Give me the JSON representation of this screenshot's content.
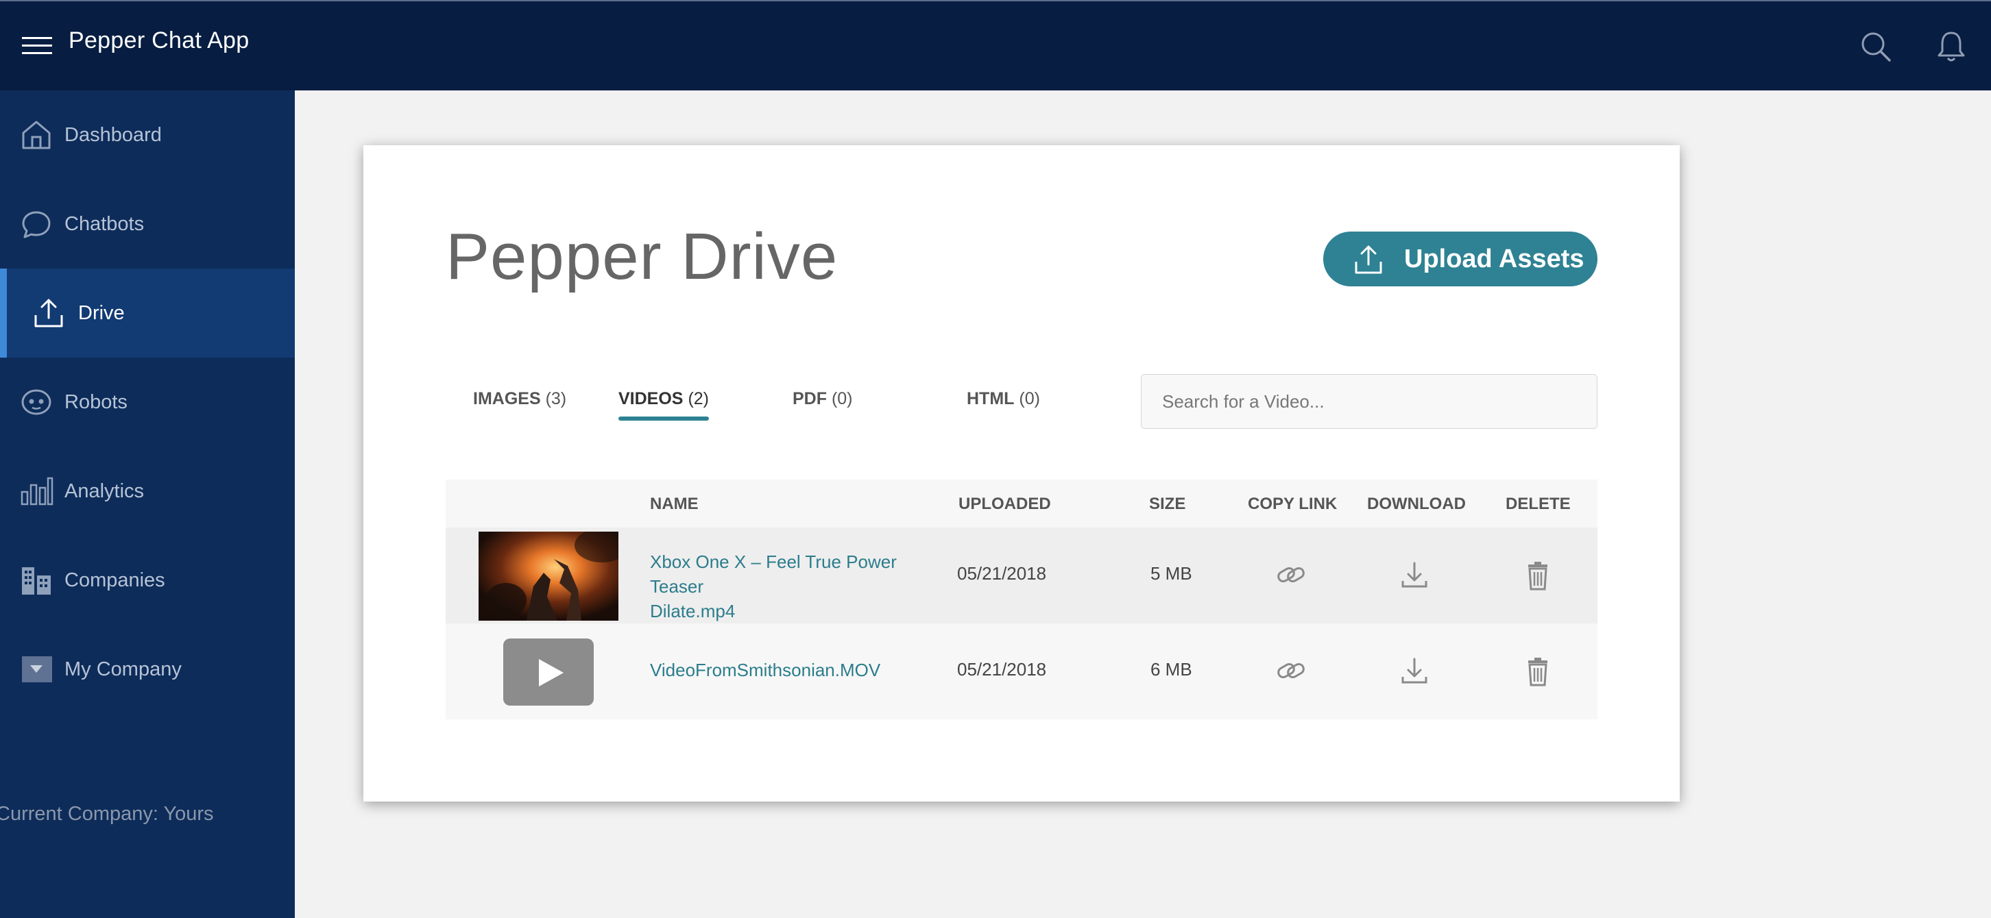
{
  "app": {
    "title": "Pepper Chat App"
  },
  "header_icons": [
    "menu-icon",
    "search-icon",
    "bell-icon"
  ],
  "sidebar": {
    "items": [
      {
        "label": "Dashboard",
        "icon": "home-icon",
        "active": false
      },
      {
        "label": "Chatbots",
        "icon": "chat-bubble-icon",
        "active": false
      },
      {
        "label": "Drive",
        "icon": "upload-icon",
        "active": true
      },
      {
        "label": "Robots",
        "icon": "robot-icon",
        "active": false
      },
      {
        "label": "Analytics",
        "icon": "bar-chart-icon",
        "active": false
      },
      {
        "label": "Companies",
        "icon": "buildings-icon",
        "active": false
      },
      {
        "label": "My Company",
        "icon": "dropdown-icon",
        "active": false
      }
    ],
    "current_company": "Current Company: Yours"
  },
  "main": {
    "title": "Pepper Drive",
    "upload_button": "Upload Assets",
    "tabs": [
      {
        "label": "IMAGES",
        "count": "(3)",
        "active": false
      },
      {
        "label": "VIDEOS",
        "count": "(2)",
        "active": true
      },
      {
        "label": "PDF",
        "count": "(0)",
        "active": false
      },
      {
        "label": "HTML",
        "count": "(0)",
        "active": false
      }
    ],
    "search": {
      "placeholder": "Search for a Video..."
    },
    "table": {
      "columns": [
        "NAME",
        "UPLOADED",
        "SIZE",
        "COPY LINK",
        "DOWNLOAD",
        "DELETE"
      ],
      "rows": [
        {
          "name_line1": "Xbox One X – Feel True Power Teaser",
          "name_line2": "Dilate.mp4",
          "uploaded": "05/21/2018",
          "size": "5 MB",
          "thumbnail": "video-frame"
        },
        {
          "name_line1": "VideoFromSmithsonian.MOV",
          "name_line2": "",
          "uploaded": "05/21/2018",
          "size": "6 MB",
          "thumbnail": "play-placeholder"
        }
      ]
    }
  },
  "colors": {
    "topbar": "#071d41",
    "sidebar": "#0d2c5a",
    "sidebar_active": "#123a73",
    "accent": "#2e8293",
    "link": "#2b7d8c"
  }
}
